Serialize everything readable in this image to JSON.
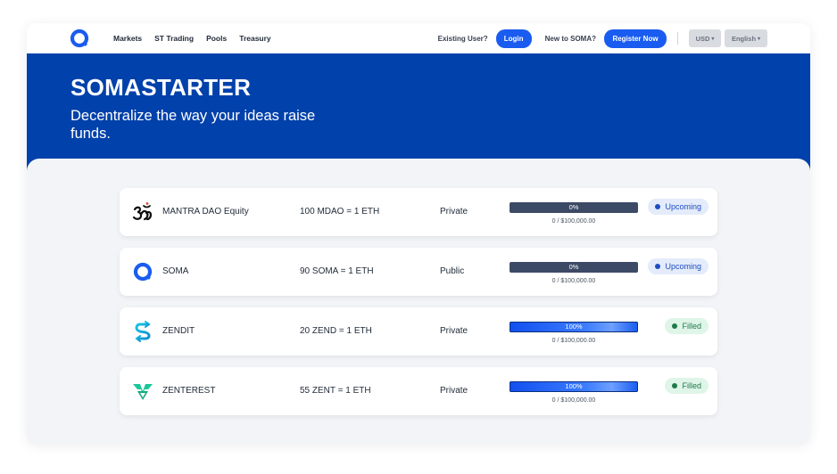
{
  "nav": {
    "links": [
      "Markets",
      "ST Trading",
      "Pools",
      "Treasury"
    ],
    "existing_user_text": "Existing User?",
    "login_label": "Login",
    "new_text": "New to SOMA?",
    "register_label": "Register Now",
    "currency": "USD",
    "language": "English"
  },
  "hero": {
    "title": "SOMASTARTER",
    "subtitle": "Decentralize the way your ideas raise funds."
  },
  "offerings": [
    {
      "name": "MANTRA DAO Equity",
      "rate": "100 MDAO = 1 ETH",
      "type": "Private",
      "progress_label": "0%",
      "progress": 0,
      "raised": "0 / $100,000.00",
      "status": "Upcoming",
      "icon": "om-icon"
    },
    {
      "name": "SOMA",
      "rate": "90 SOMA = 1 ETH",
      "type": "Public",
      "progress_label": "0%",
      "progress": 0,
      "raised": "0 / $100,000.00",
      "status": "Upcoming",
      "icon": "soma-logo-icon"
    },
    {
      "name": "ZENDIT",
      "rate": "20 ZEND = 1 ETH",
      "type": "Private",
      "progress_label": "100%",
      "progress": 100,
      "raised": "0 / $100,000.00",
      "status": "Filled",
      "icon": "zendit-logo-icon"
    },
    {
      "name": "ZENTEREST",
      "rate": "55 ZENT = 1 ETH",
      "type": "Private",
      "progress_label": "100%",
      "progress": 100,
      "raised": "0 / $100,000.00",
      "status": "Filled",
      "icon": "zenterest-logo-icon"
    }
  ],
  "colors": {
    "brand_blue": "#0041ab",
    "button_blue": "#1a5cf0",
    "upcoming": "#1d4ec0",
    "filled": "#1f7a4a"
  }
}
